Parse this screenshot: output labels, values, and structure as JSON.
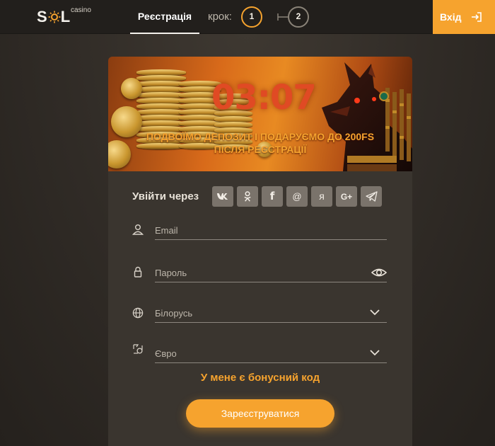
{
  "header": {
    "logo_main": "SOL",
    "logo_sub": "casino",
    "tab_registration": "Реєстрація",
    "step_label": "крок:",
    "step_1": "1",
    "step_2": "2",
    "login_label": "Вхід"
  },
  "banner": {
    "timer": "03:07",
    "promo_line1": "ПОДВОЇМО ДЕПОЗИТ І ПОДАРУЄМО ДО 200FS",
    "promo_line2": "ПІСЛЯ РЕЄСТРАЦІЇ"
  },
  "social": {
    "label": "Увійти через",
    "buttons": [
      {
        "name": "vk",
        "glyph": "vk"
      },
      {
        "name": "odnoklassniki",
        "glyph": "ok"
      },
      {
        "name": "facebook",
        "glyph": "f"
      },
      {
        "name": "mail",
        "glyph": "@"
      },
      {
        "name": "yandex",
        "glyph": "я"
      },
      {
        "name": "google-plus",
        "glyph": "G+"
      },
      {
        "name": "telegram",
        "glyph": "telegram"
      }
    ]
  },
  "form": {
    "email_placeholder": "Email",
    "password_placeholder": "Пароль",
    "country": "Білорусь",
    "currency": "Євро",
    "bonus_link": "У мене є бонусний код",
    "submit": "Зареєструватися"
  },
  "colors": {
    "accent": "#f6a32e",
    "timer": "#e04a24",
    "header_bg": "#221f1c",
    "card_bg": "#3a352f",
    "social_btn_bg": "#7a736b"
  },
  "icons": {
    "email": "user-icon",
    "password": "lock-icon",
    "country": "globe-icon",
    "currency": "currency-icon",
    "password_toggle": "eye-icon",
    "dropdown": "chevron-down-icon",
    "login": "sign-in-icon"
  }
}
